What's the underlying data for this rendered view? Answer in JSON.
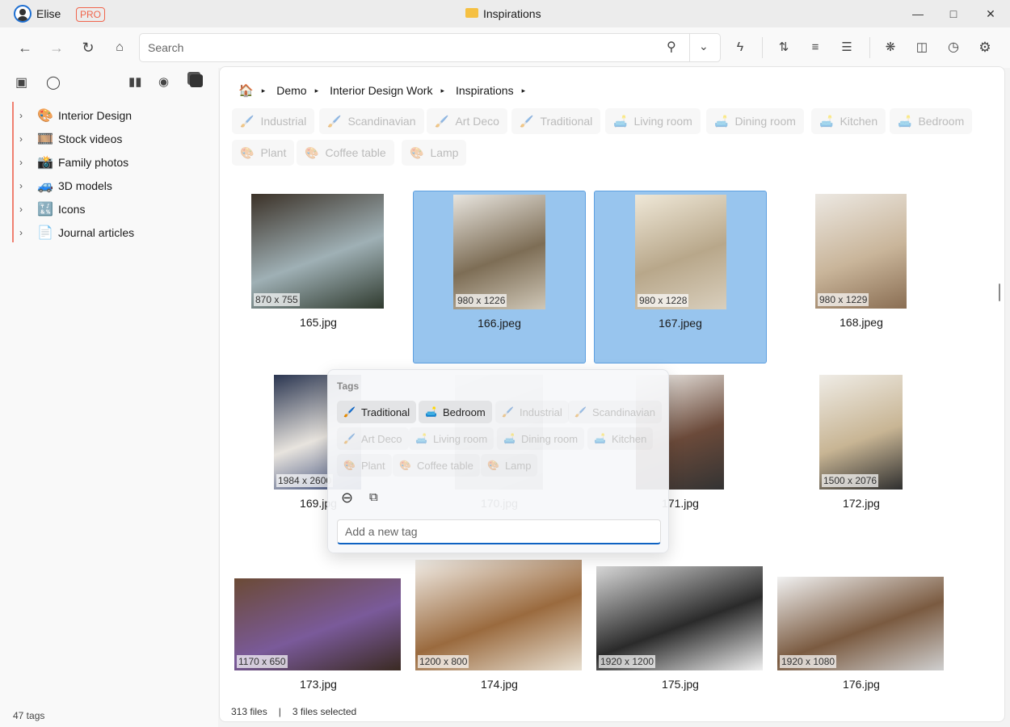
{
  "titlebar": {
    "user": "Elise",
    "badge": "PRO",
    "title": "Inspirations",
    "folder_icon": "folder-icon"
  },
  "toolbar": {
    "search_placeholder": "Search"
  },
  "sidebar": {
    "items": [
      {
        "label": "Interior Design",
        "icon": "🎨"
      },
      {
        "label": "Stock videos",
        "icon": "🎞️"
      },
      {
        "label": "Family photos",
        "icon": "📸"
      },
      {
        "label": "3D models",
        "icon": "🚙"
      },
      {
        "label": "Icons",
        "icon": "🔣"
      },
      {
        "label": "Journal articles",
        "icon": "📄"
      }
    ],
    "footer": "47 tags"
  },
  "breadcrumb": {
    "home_icon": "🏠",
    "items": [
      "Demo",
      "Interior Design Work",
      "Inspirations"
    ]
  },
  "filter_tags": [
    {
      "label": "Industrial",
      "icon": "🖌️"
    },
    {
      "label": "Scandinavian",
      "icon": "🖌️"
    },
    {
      "label": "Art Deco",
      "icon": "🖌️"
    },
    {
      "label": "Traditional",
      "icon": "🖌️"
    },
    {
      "label": "Living room",
      "icon": "🛋️"
    },
    {
      "label": "Dining room",
      "icon": "🛋️"
    },
    {
      "label": "Kitchen",
      "icon": "🛋️"
    },
    {
      "label": "Bedroom",
      "icon": "🛋️"
    },
    {
      "label": "Plant",
      "icon": "🎨"
    },
    {
      "label": "Coffee table",
      "icon": "🎨"
    },
    {
      "label": "Lamp",
      "icon": "🎨"
    }
  ],
  "files": [
    {
      "name": "165.jpg",
      "dims": "870 x 755",
      "w": 870,
      "h": 755,
      "selected": false,
      "colors": [
        "#3b3127",
        "#9fb0b5",
        "#2f3a2e"
      ]
    },
    {
      "name": "166.jpeg",
      "dims": "980 x 1226",
      "w": 980,
      "h": 1226,
      "selected": true,
      "colors": [
        "#e8e5df",
        "#7d6d55",
        "#cfc7b7"
      ]
    },
    {
      "name": "167.jpeg",
      "dims": "980 x 1228",
      "w": 980,
      "h": 1228,
      "selected": true,
      "colors": [
        "#efe8d8",
        "#b8a78a",
        "#d9cfbd"
      ]
    },
    {
      "name": "168.jpeg",
      "dims": "980 x 1229",
      "w": 980,
      "h": 1229,
      "selected": false,
      "colors": [
        "#ece8e2",
        "#c9b59a",
        "#8a6e53"
      ]
    },
    {
      "name": "169.jpg",
      "dims": "1984 x 2600",
      "w": 1984,
      "h": 2600,
      "selected": false,
      "colors": [
        "#2a3550",
        "#e8e4de",
        "#3a4a78"
      ]
    },
    {
      "name": "170.jpg",
      "dims": "",
      "w": 1000,
      "h": 1300,
      "selected": false,
      "colors": [
        "#ddd",
        "#bbb",
        "#999"
      ]
    },
    {
      "name": "171.jpg",
      "dims": "",
      "w": 1000,
      "h": 1300,
      "selected": false,
      "colors": [
        "#f0eeea",
        "#6b4a3a",
        "#333"
      ]
    },
    {
      "name": "172.jpg",
      "dims": "1500 x 2076",
      "w": 1500,
      "h": 2076,
      "selected": false,
      "colors": [
        "#efece6",
        "#c8b594",
        "#2f2f2f"
      ]
    },
    {
      "name": "173.jpg",
      "dims": "1170 x 650",
      "w": 1170,
      "h": 650,
      "selected": false,
      "colors": [
        "#6b4a35",
        "#7a5a9a",
        "#3a2a22"
      ]
    },
    {
      "name": "174.jpg",
      "dims": "1200 x 800",
      "w": 1200,
      "h": 800,
      "selected": false,
      "colors": [
        "#f2eee8",
        "#9a6a3e",
        "#e8e0d2"
      ]
    },
    {
      "name": "175.jpg",
      "dims": "1920 x 1200",
      "w": 1920,
      "h": 1200,
      "selected": false,
      "colors": [
        "#d8d8d8",
        "#2a2a2a",
        "#f0f0f0"
      ]
    },
    {
      "name": "176.jpg",
      "dims": "1920 x 1080",
      "w": 1920,
      "h": 1080,
      "selected": false,
      "colors": [
        "#f1f1f1",
        "#7a5a40",
        "#cfcfcf"
      ]
    }
  ],
  "popup": {
    "title": "Tags",
    "tags": [
      {
        "label": "Traditional",
        "icon": "🖌️",
        "on": true
      },
      {
        "label": "Bedroom",
        "icon": "🛋️",
        "on": true
      },
      {
        "label": "Industrial",
        "icon": "🖌️",
        "on": false
      },
      {
        "label": "Scandinavian",
        "icon": "🖌️",
        "on": false
      },
      {
        "label": "Art Deco",
        "icon": "🖌️",
        "on": false
      },
      {
        "label": "Living room",
        "icon": "🛋️",
        "on": false
      },
      {
        "label": "Dining room",
        "icon": "🛋️",
        "on": false
      },
      {
        "label": "Kitchen",
        "icon": "🛋️",
        "on": false
      },
      {
        "label": "Plant",
        "icon": "🎨",
        "on": false
      },
      {
        "label": "Coffee table",
        "icon": "🎨",
        "on": false
      },
      {
        "label": "Lamp",
        "icon": "🎨",
        "on": false
      }
    ],
    "input_placeholder": "Add a new tag"
  },
  "status": {
    "count": "313 files",
    "separator": "|",
    "selected": "3 files selected"
  }
}
